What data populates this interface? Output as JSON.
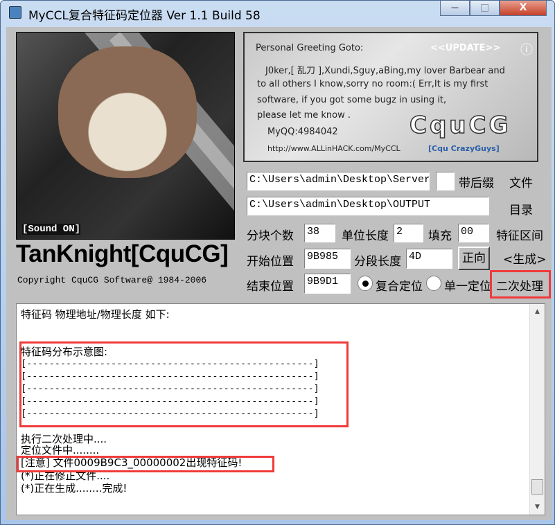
{
  "window": {
    "title": "MyCCL复合特征码定位器  Ver 1.1  Build 58",
    "minimize": "—",
    "maximize": "□",
    "close": "X"
  },
  "left": {
    "sound_label": "[Sound ON]",
    "brand": "TanKnight[CquCG]",
    "copyright": "Copyright CquCG Software@ 1984-2006"
  },
  "greeting": {
    "heading": "Personal Greeting Goto:",
    "update": "<<UPDATE>>",
    "info_icon": "ⓘ",
    "lines": [
      "J0ker,[ 乱刀 ],Xundi,Sguy,aBing,my lover Barbear and",
      "to all others I know,sorry no room:(  Err,It is my first",
      "software, if you got some bugz in using it,",
      "please let me know ."
    ],
    "qq": "MyQQ:4984042",
    "url": "http://www.ALLinHACK.com/MyCCL",
    "logo": "CquCG",
    "logo_sub": "[Cqu CrazyGuys]"
  },
  "form": {
    "file_path": "C:\\Users\\admin\\Desktop\\Server",
    "suffix_label": "带后缀",
    "file_button": "文件",
    "output_path": "C:\\Users\\admin\\Desktop\\OUTPUT",
    "dir_button": "目录",
    "block_count_label": "分块个数",
    "block_count": "38",
    "unit_len_label": "单位长度",
    "unit_len": "2",
    "fill_label": "填充",
    "fill": "00",
    "range_button": "特征区间",
    "start_label": "开始位置",
    "start": "9B985",
    "seg_len_label": "分段长度",
    "seg_len": "4D",
    "direction_button": "正向",
    "generate_button": "<生成>",
    "end_label": "结束位置",
    "end": "9B9D1",
    "mode_composite": "复合定位",
    "mode_single": "单一定位",
    "selected_mode": "复合定位",
    "secondary_button": "二次处理"
  },
  "log": {
    "lines": [
      "特征码 物理地址/物理长度 如下:",
      "特征码分布示意图:",
      "[---------------------------------------------------]",
      "[---------------------------------------------------]",
      "[---------------------------------------------------]",
      "[---------------------------------------------------]",
      "[---------------------------------------------------]",
      "执行二次处理中....",
      "定位文件中........",
      "[注意] 文件0009B9C3_00000002出现特征码!",
      "(*)正在修正文件....",
      "(*)正在生成........完成!"
    ]
  },
  "colors": {
    "highlight": "#f03a3a",
    "client": "#c0c0c0"
  }
}
